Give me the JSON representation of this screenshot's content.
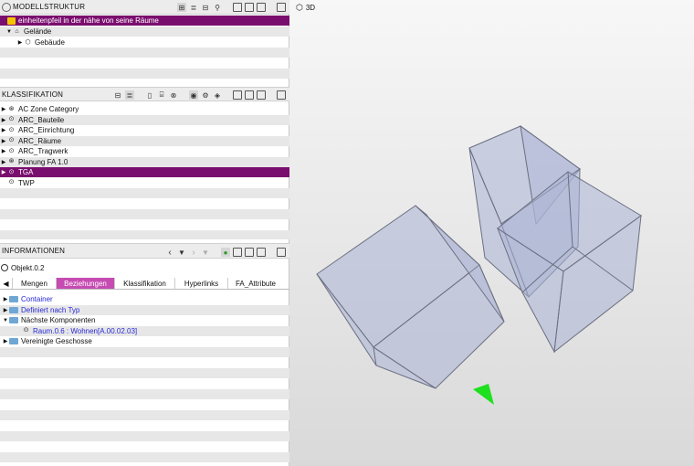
{
  "modellstruktur": {
    "title": "MODELLSTRUKTUR",
    "rows": [
      {
        "label": "einheitenpfeil in der nähe von seine Räume",
        "selected": true
      },
      {
        "label": "Gelände"
      },
      {
        "label": "Gebäude"
      }
    ]
  },
  "klassifikation": {
    "title": "KLASSIFIKATION",
    "rows": [
      {
        "label": "AC Zone Category"
      },
      {
        "label": "ARC_Bauteile"
      },
      {
        "label": "ARC_Einrichtung"
      },
      {
        "label": "ARC_Räume"
      },
      {
        "label": "ARC_Tragwerk"
      },
      {
        "label": "Planung FA 1.0"
      },
      {
        "label": "TGA",
        "selected": true
      },
      {
        "label": "TWP"
      }
    ]
  },
  "informationen": {
    "title": "INFORMATIONEN",
    "object": "Objekt.0.2",
    "tabs": [
      "Mengen",
      "Beziehungen",
      "Klassifikation",
      "Hyperlinks",
      "FA_Attribute"
    ],
    "active_tab": "Beziehungen",
    "rows": [
      {
        "label": "Container"
      },
      {
        "label": "Definiert nach Typ"
      },
      {
        "label": "Nächste Komponenten"
      },
      {
        "label": "Raum.0.6 : Wohnen[A.00.02.03]"
      },
      {
        "label": "Vereinigte Geschosse"
      }
    ]
  },
  "viewport": {
    "title": "3D"
  },
  "colors": {
    "selection": "#7a0e6e",
    "active_tab": "#c64bb2",
    "arrow": "#1ee01e",
    "box_fill": "#aab2d4"
  }
}
